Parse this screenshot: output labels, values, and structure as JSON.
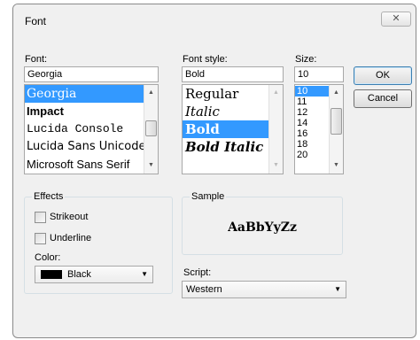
{
  "dialog": {
    "title": "Font",
    "close_icon": "x-icon",
    "close_glyph": "✕"
  },
  "font": {
    "label": "Font:",
    "value": "Georgia",
    "items": [
      "Georgia",
      "Impact",
      "Lucida Console",
      "Lucida Sans Unicode",
      "Microsoft Sans Serif"
    ],
    "selected": "Georgia"
  },
  "style": {
    "label": "Font style:",
    "value": "Bold",
    "items": [
      "Regular",
      "Italic",
      "Bold",
      "Bold Italic"
    ],
    "selected": "Bold"
  },
  "size": {
    "label": "Size:",
    "value": "10",
    "items": [
      "10",
      "11",
      "12",
      "14",
      "16",
      "18",
      "20"
    ],
    "selected": "10"
  },
  "buttons": {
    "ok": "OK",
    "cancel": "Cancel"
  },
  "effects": {
    "title": "Effects",
    "strikeout": "Strikeout",
    "strikeout_checked": false,
    "underline": "Underline",
    "underline_checked": false,
    "color_label": "Color:",
    "color_value": "Black",
    "color_hex": "#000000"
  },
  "sample": {
    "title": "Sample",
    "text": "AaBbYyZz"
  },
  "script": {
    "label": "Script:",
    "value": "Western"
  },
  "icons": {
    "up": "▲",
    "down": "▼",
    "dropdown": "▼"
  },
  "colors": {
    "selection": "#3399ff",
    "dialog_bg": "#f0f0f0"
  }
}
